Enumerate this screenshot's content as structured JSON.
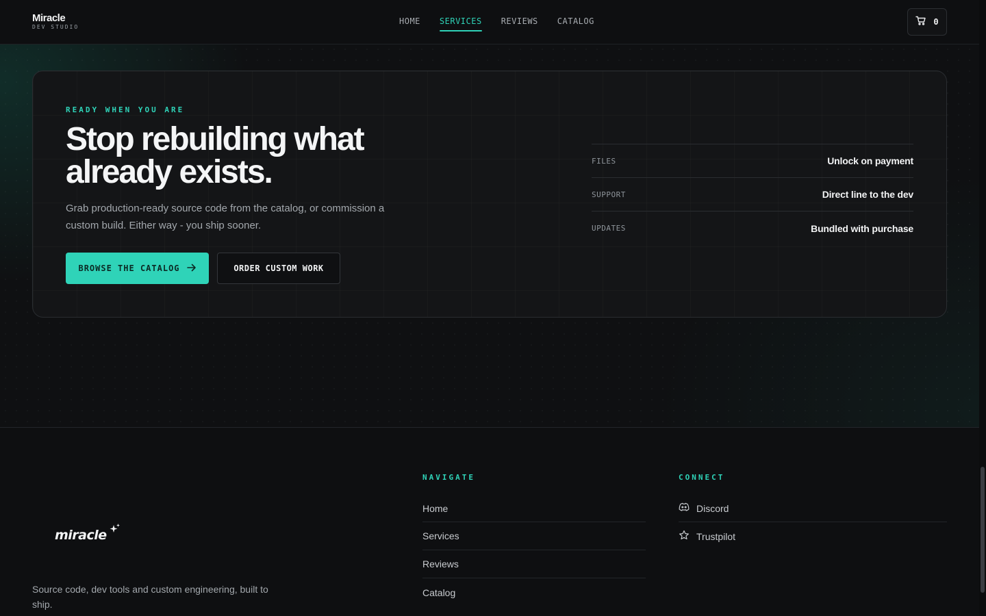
{
  "header": {
    "brand_name": "Miracle",
    "brand_sub": "DEV STUDIO",
    "nav": [
      {
        "label": "HOME",
        "active": false
      },
      {
        "label": "SERVICES",
        "active": true
      },
      {
        "label": "REVIEWS",
        "active": false
      },
      {
        "label": "CATALOG",
        "active": false
      }
    ],
    "cart_count": "0",
    "cart_icon": "cart-icon"
  },
  "cta": {
    "eyebrow": "READY WHEN YOU ARE",
    "headline": "Stop rebuilding what already exists.",
    "subcopy": "Grab production-ready source code from the catalog, or commission a custom build. Either way - you ship sooner.",
    "primary_button": "BROWSE THE CATALOG",
    "primary_icon": "arrow-right-icon",
    "secondary_button": "ORDER CUSTOM WORK",
    "specs": [
      {
        "key": "FILES",
        "value": "Unlock on payment"
      },
      {
        "key": "SUPPORT",
        "value": "Direct line to the dev"
      },
      {
        "key": "UPDATES",
        "value": "Bundled with purchase"
      }
    ]
  },
  "footer": {
    "logo_text": "miracle",
    "tagline": "Source code, dev tools and custom engineering, built to ship.",
    "navigate_title": "NAVIGATE",
    "navigate_links": [
      "Home",
      "Services",
      "Reviews",
      "Catalog"
    ],
    "connect_title": "CONNECT",
    "connect_links": [
      {
        "label": "Discord",
        "icon": "discord-icon"
      },
      {
        "label": "Trustpilot",
        "icon": "star-icon"
      }
    ]
  },
  "colors": {
    "accent": "#2fd3b8",
    "background": "#0f1012",
    "card": "#141517"
  }
}
